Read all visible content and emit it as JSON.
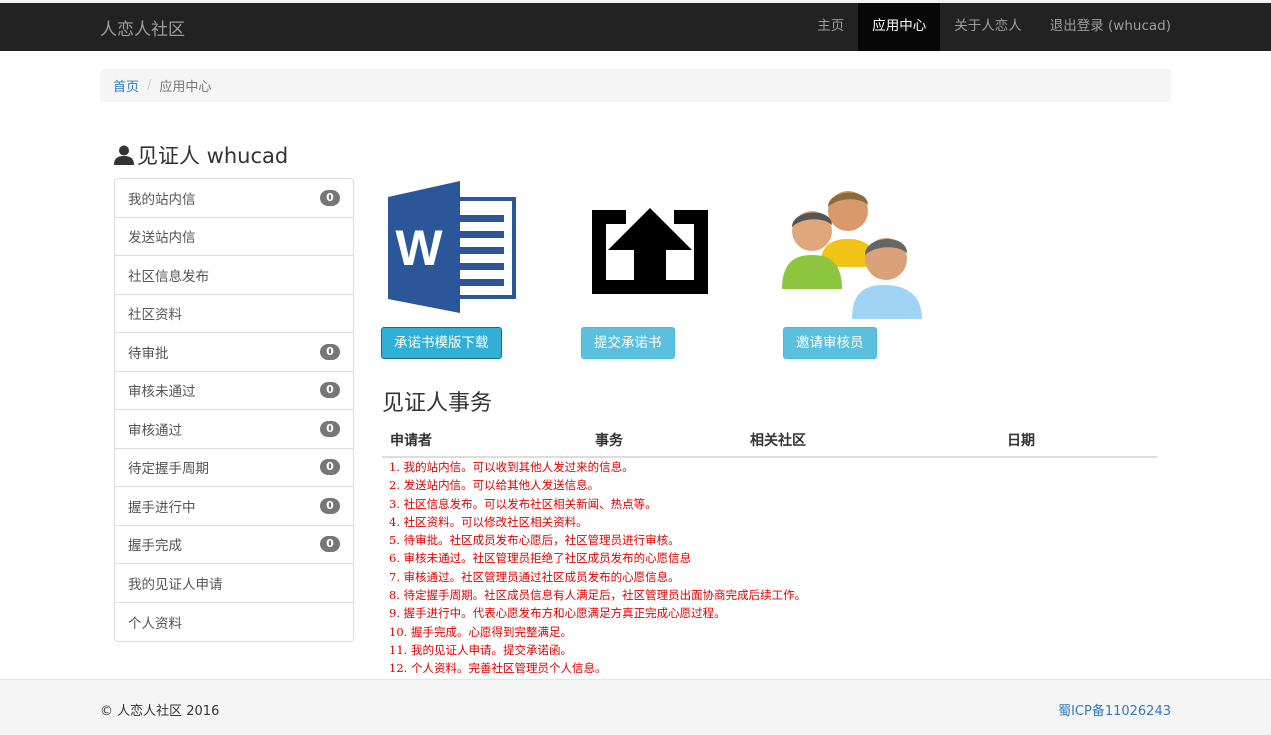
{
  "navbar": {
    "brand": "人恋人社区",
    "items": [
      {
        "label": "主页"
      },
      {
        "label": "应用中心"
      },
      {
        "label": "关于人恋人"
      },
      {
        "label": "退出登录 (whucad)"
      }
    ],
    "active_index": 1,
    "colors": {
      "background": "#222222",
      "active": "#080808",
      "text": "#9d9d9d"
    }
  },
  "breadcrumb": {
    "home": "首页",
    "separator": "/",
    "current": "应用中心"
  },
  "profile": {
    "icon": "user-icon",
    "title": "见证人 whucad"
  },
  "sidebar": {
    "items": [
      {
        "label": "我的站内信",
        "badge": "0"
      },
      {
        "label": "发送站内信"
      },
      {
        "label": "社区信息发布"
      },
      {
        "label": "社区资料"
      },
      {
        "label": "待审批",
        "badge": "0"
      },
      {
        "label": "审核未通过",
        "badge": "0"
      },
      {
        "label": "审核通过",
        "badge": "0"
      },
      {
        "label": "待定握手周期",
        "badge": "0"
      },
      {
        "label": "握手进行中",
        "badge": "0"
      },
      {
        "label": "握手完成",
        "badge": "0"
      },
      {
        "label": "我的见证人申请"
      },
      {
        "label": "个人资料"
      }
    ]
  },
  "apps": [
    {
      "icon": "word-document-icon",
      "button": "承诺书模版下载"
    },
    {
      "icon": "upload-icon",
      "button": "提交承诺书"
    },
    {
      "icon": "users-group-icon",
      "button": "邀请审核员"
    }
  ],
  "affairs": {
    "title": "见证人事务",
    "columns": [
      "申请者",
      "事务",
      "相关社区",
      "日期"
    ],
    "notes": [
      "1. 我的站内信。可以收到其他人发过来的信息。",
      "2. 发送站内信。可以给其他人发送信息。",
      "3. 社区信息发布。可以发布社区相关新闻、热点等。",
      "4. 社区资料。可以修改社区相关资料。",
      "5. 待审批。社区成员发布心愿后，社区管理员进行审核。",
      "6. 审核未通过。社区管理员拒绝了社区成员发布的心愿信息",
      "7. 审核通过。社区管理员通过社区成员发布的心愿信息。",
      "8. 待定握手周期。社区成员信息有人满足后，社区管理员出面协商完成后续工作。",
      "9. 握手进行中。代表心愿发布方和心愿满足方真正完成心愿过程。",
      "10. 握手完成。心愿得到完整满足。",
      "11. 我的见证人申请。提交承诺函。",
      "12. 个人资料。完善社区管理员个人信息。"
    ],
    "note_color": "#e00000"
  },
  "footer": {
    "copyright": "© 人恋人社区 2016",
    "icp": "蜀ICP备11026243"
  }
}
